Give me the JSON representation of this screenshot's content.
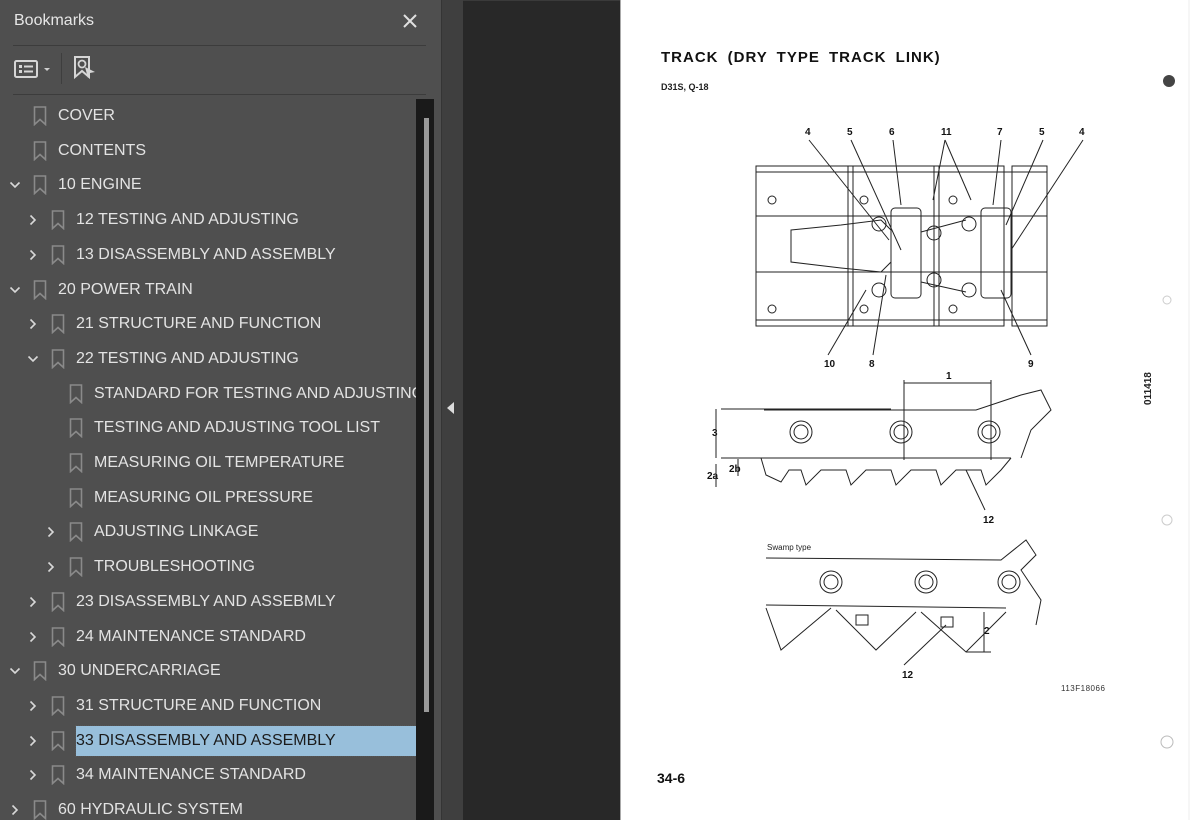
{
  "bookmarks_panel": {
    "title": "Bookmarks",
    "close_icon": "close-icon",
    "toolbar": {
      "options_icon": "list-options-icon",
      "find_current_icon": "find-current-bookmark-icon"
    },
    "items": [
      {
        "label": "COVER",
        "level": 0,
        "expander": "none"
      },
      {
        "label": "CONTENTS",
        "level": 0,
        "expander": "none"
      },
      {
        "label": "10 ENGINE",
        "level": 0,
        "expander": "expanded"
      },
      {
        "label": "12 TESTING AND ADJUSTING",
        "level": 1,
        "expander": "collapsed"
      },
      {
        "label": "13 DISASSEMBLY AND ASSEMBLY",
        "level": 1,
        "expander": "collapsed"
      },
      {
        "label": "20 POWER TRAIN",
        "level": 0,
        "expander": "expanded"
      },
      {
        "label": "21 STRUCTURE AND FUNCTION",
        "level": 1,
        "expander": "collapsed"
      },
      {
        "label": "22 TESTING AND ADJUSTING",
        "level": 1,
        "expander": "expanded"
      },
      {
        "label": "STANDARD FOR TESTING AND ADJUSTING",
        "level": 2,
        "expander": "none"
      },
      {
        "label": "TESTING AND ADJUSTING TOOL LIST",
        "level": 2,
        "expander": "none"
      },
      {
        "label": "MEASURING OIL TEMPERATURE",
        "level": 2,
        "expander": "none"
      },
      {
        "label": "MEASURING OIL PRESSURE",
        "level": 2,
        "expander": "none"
      },
      {
        "label": "ADJUSTING LINKAGE",
        "level": 2,
        "expander": "collapsed"
      },
      {
        "label": "TROUBLESHOOTING",
        "level": 2,
        "expander": "collapsed"
      },
      {
        "label": "23 DISASSEMBLY AND ASSEBMLY",
        "level": 1,
        "expander": "collapsed"
      },
      {
        "label": "24 MAINTENANCE STANDARD",
        "level": 1,
        "expander": "collapsed"
      },
      {
        "label": "30 UNDERCARRIAGE",
        "level": 0,
        "expander": "expanded"
      },
      {
        "label": "31 STRUCTURE AND FUNCTION",
        "level": 1,
        "expander": "collapsed"
      },
      {
        "label": "33 DISASSEMBLY AND ASSEMBLY",
        "level": 1,
        "expander": "collapsed",
        "selected": true
      },
      {
        "label": "34 MAINTENANCE STANDARD",
        "level": 1,
        "expander": "collapsed"
      },
      {
        "label": "60 HYDRAULIC SYSTEM",
        "level": 0,
        "expander": "collapsed"
      }
    ],
    "selection_color": "#98bfdb"
  },
  "splitter": {
    "toggle_icon": "collapse-panel-arrow-icon"
  },
  "document": {
    "title": "TRACK  (DRY  TYPE  TRACK  LINK)",
    "model": "D31S, Q-18",
    "page_number": "34-6",
    "figure_code": "113F18066",
    "side_code": "011418",
    "swamp_label": "Swamp type",
    "callouts_top": [
      "4",
      "5",
      "6",
      "11",
      "7",
      "5",
      "4"
    ],
    "callouts_bottom_plan": [
      "10",
      "8",
      "9"
    ],
    "callouts_side": [
      "1",
      "3",
      "2a",
      "2b",
      "12"
    ],
    "callouts_swamp": [
      "2",
      "12"
    ]
  }
}
